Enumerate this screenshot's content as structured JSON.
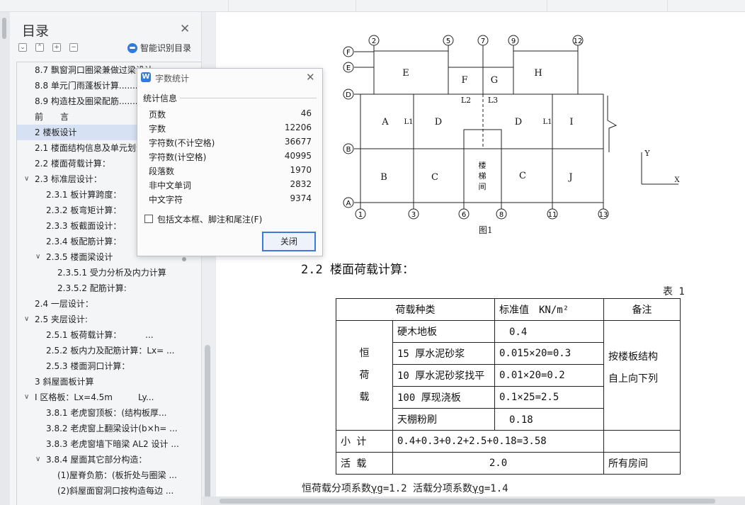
{
  "toc": {
    "title": "目录",
    "smart_label": "智能识别目录",
    "items": [
      {
        "label": "8.7 飘窗洞口圈梁兼做过梁设计",
        "indent": 1,
        "caret": "",
        "selected": false
      },
      {
        "label": "8.8 单元门雨蓬板计算.......",
        "indent": 1,
        "caret": "",
        "selected": false
      },
      {
        "label": "8.9 构造柱及圈梁配筋.......",
        "indent": 1,
        "caret": "",
        "selected": false
      },
      {
        "label": "前　　言",
        "indent": 1,
        "caret": "",
        "selected": false
      },
      {
        "label": "2 楼板设计",
        "indent": 1,
        "caret": "",
        "selected": true
      },
      {
        "label": "2.1 楼面结构信息及单元划分",
        "indent": 1,
        "caret": "",
        "selected": false
      },
      {
        "label": "2.2 楼面荷载计算：",
        "indent": 1,
        "caret": "",
        "selected": false
      },
      {
        "label": "2.3 标准层设计：",
        "indent": 1,
        "caret": "v",
        "selected": false
      },
      {
        "label": "2.3.1 板计算跨度：",
        "indent": 2,
        "caret": "",
        "selected": false
      },
      {
        "label": "2.3.2 板弯矩计算：",
        "indent": 2,
        "caret": "",
        "selected": false
      },
      {
        "label": "2.3.3 板截面设计：",
        "indent": 2,
        "caret": "",
        "selected": false
      },
      {
        "label": "2.3.4 板配筋计算：",
        "indent": 2,
        "caret": "",
        "selected": false
      },
      {
        "label": "2.3.5 楼面梁设计",
        "indent": 2,
        "caret": "v",
        "selected": false
      },
      {
        "label": "2.3.5.1 受力分析及内力计算",
        "indent": 3,
        "caret": "",
        "selected": false
      },
      {
        "label": "2.3.5.2 配筋计算:",
        "indent": 3,
        "caret": "",
        "selected": false
      },
      {
        "label": "2.4 一层设计：",
        "indent": 1,
        "caret": "",
        "selected": false
      },
      {
        "label": "2.5 夹层设计:",
        "indent": 1,
        "caret": "v",
        "selected": false
      },
      {
        "label": "2.5.1 板荷载计算：　　　 ...",
        "indent": 2,
        "caret": "",
        "selected": false
      },
      {
        "label": "2.5.2 板内力及配筋计算：Lx= ...",
        "indent": 2,
        "caret": "",
        "selected": false
      },
      {
        "label": "2.5.3 楼面洞口计算：",
        "indent": 2,
        "caret": "",
        "selected": false
      },
      {
        "label": "3 斜屋面板计算",
        "indent": 1,
        "caret": "",
        "selected": false
      },
      {
        "label": "Ⅰ 区格板：Lx=4.5m　　　Ly...",
        "indent": 1,
        "caret": "v",
        "selected": false
      },
      {
        "label": "3.8.1 老虎窗顶板：(结构板厚...",
        "indent": 2,
        "caret": "",
        "selected": false
      },
      {
        "label": "3.8.2 老虎窗上翻梁设计(b×h= ...",
        "indent": 2,
        "caret": "",
        "selected": false
      },
      {
        "label": "3.8.3 老虎窗墙下暗梁 AL2 设计 ...",
        "indent": 2,
        "caret": "",
        "selected": false
      },
      {
        "label": "3.8.4 屋面其它部分构造：",
        "indent": 2,
        "caret": "v",
        "selected": false
      },
      {
        "label": "(1)屋脊负筋：(板折处与圈梁 ...",
        "indent": 3,
        "caret": "",
        "selected": false
      },
      {
        "label": "(2)斜屋面窗洞口按构造每边 ...",
        "indent": 3,
        "caret": "",
        "selected": false
      }
    ]
  },
  "dialog": {
    "title": "字数统计",
    "section": "统计信息",
    "stats": [
      {
        "key": "页数",
        "value": "46"
      },
      {
        "key": "字数",
        "value": "12206"
      },
      {
        "key": "字符数(不计空格)",
        "value": "36677"
      },
      {
        "key": "字符数(计空格)",
        "value": "40995"
      },
      {
        "key": "段落数",
        "value": "1970"
      },
      {
        "key": "非中文单词",
        "value": "2832"
      },
      {
        "key": "中文字符",
        "value": "9374"
      }
    ],
    "checkbox_label": "包括文本框、脚注和尾注(F)",
    "checkbox_checked": false,
    "close_label": "关闭"
  },
  "document": {
    "plan": {
      "axis_top": [
        "2",
        "5",
        "7",
        "9",
        "12"
      ],
      "axis_bottom": [
        "1",
        "3",
        "6",
        "8",
        "11",
        "13"
      ],
      "axis_left": [
        "F",
        "E",
        "D",
        "B",
        "A"
      ],
      "rooms": [
        "E",
        "F",
        "G",
        "H",
        "A",
        "D",
        "D",
        "I",
        "B",
        "C",
        "C",
        "J"
      ],
      "beam_labels": [
        "L2",
        "L3",
        "L1",
        "L1"
      ],
      "stair_label": [
        "楼",
        "梯",
        "间"
      ],
      "axis_x": "X",
      "axis_y": "Y"
    },
    "figure_caption": "图1",
    "section_heading": "2.2 楼面荷载计算：",
    "table_label": "表 1",
    "table": {
      "headers": [
        "荷载种类",
        "标准值　KN/m²",
        "备注"
      ],
      "dead_label": [
        "恒",
        "荷",
        "载"
      ],
      "dead_rows": [
        {
          "name": "硬木地板",
          "value": "　0.4"
        },
        {
          "name": "15 厚水泥砂浆",
          "value": "0.015×20=0.3"
        },
        {
          "name": "10 厚水泥砂浆找平",
          "value": "0.01×20=0.2"
        },
        {
          "name": "100 厚现浇板",
          "value": "0.1×25=2.5"
        },
        {
          "name": "天棚粉刷",
          "value": "　0.18"
        }
      ],
      "dead_note": [
        "按楼板结构",
        "自上向下列"
      ],
      "subtotal_label": "小 计",
      "subtotal_value": "0.4+0.3+0.2+2.5+0.18=3.58",
      "live_label": "活 载",
      "live_value": "2.0",
      "live_note": "所有房间"
    },
    "footline": {
      "part1": "恒荷载分项系数",
      "gamma1": "γg",
      "part2": "=1.2 活载分项系数",
      "gamma2": "γg",
      "part3": "=1.4"
    }
  }
}
